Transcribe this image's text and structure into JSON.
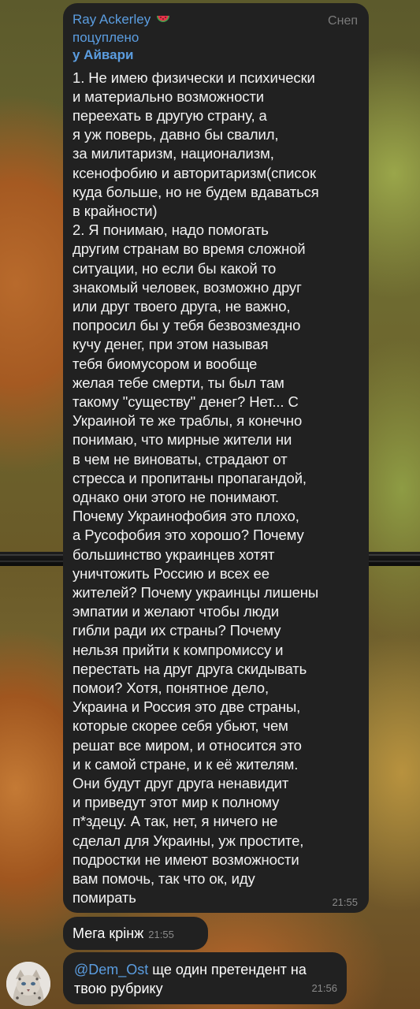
{
  "forwarded_message": {
    "sender": "Ray Ackerley",
    "sender_tag": "Снеп",
    "forwarded_label": "поцуплено",
    "forwarded_from": "у Айвари",
    "text": "1. Не имею физически и психически\nи материально возможности\nпереехать в другую страну, а\nя уж поверь, давно бы свалил,\nза милитаризм, национализм,\nксенофобию и авторитаризм(список\nкуда больше, но не будем вдаваться\nв крайности)\n2. Я понимаю, надо помогать\nдругим странам во время сложной\nситуации, но если бы какой то\nзнакомый человек, возможно друг\nили друг твоего друга, не важно,\nпопросил бы у тебя безвозмездно\nкучу денег, при этом называя\nтебя биомусором и вообще\nжелая тебе смерти, ты был там\nтакому \"существу\" денег? Нет... С\nУкраиной те же траблы, я конечно\nпонимаю, что мирные жители ни\nв чем не виноваты, страдают от\nстресса и пропитаны пропагандой,\nоднако они этого не понимают.\nПочему Украинофобия это плохо,\nа Русофобия это хорошо? Почему\nбольшинство украинцев хотят\nуничтожить Россию и всех ее\nжителей? Почему украинцы лишены\nэмпатии и желают чтобы люди\nгибли ради их страны? Почему\nнельзя прийти к компромиссу и\nперестать на друг друга скидывать\nпомои? Хотя, понятное дело,\nУкраина и Россия это две страны,\nкоторые скорее себя убьют, чем\nрешат все миром, и относится это\nи к самой стране, и к её жителям.\nОни будут друг друга ненавидит\nи приведут этот мир к полному\nп*здецу. А так, нет, я ничего не\nсделал для Украины, уж простите,\nподростки не имеют возможности\nвам помочь, так что ок, иду\nпомирать",
    "time": "21:55"
  },
  "message2": {
    "text": "Мега крінж",
    "time": "21:55"
  },
  "message3": {
    "mention": "@Dem_Ost",
    "text": " ще один претендент на твою рубрику",
    "time": "21:56"
  },
  "icons": {
    "sender_emoji": "watermelon-icon",
    "avatar": "snow-leopard-avatar"
  },
  "colors": {
    "bubble": "#212121",
    "accent": "#5b9de0",
    "time": "#8a8a8a"
  }
}
